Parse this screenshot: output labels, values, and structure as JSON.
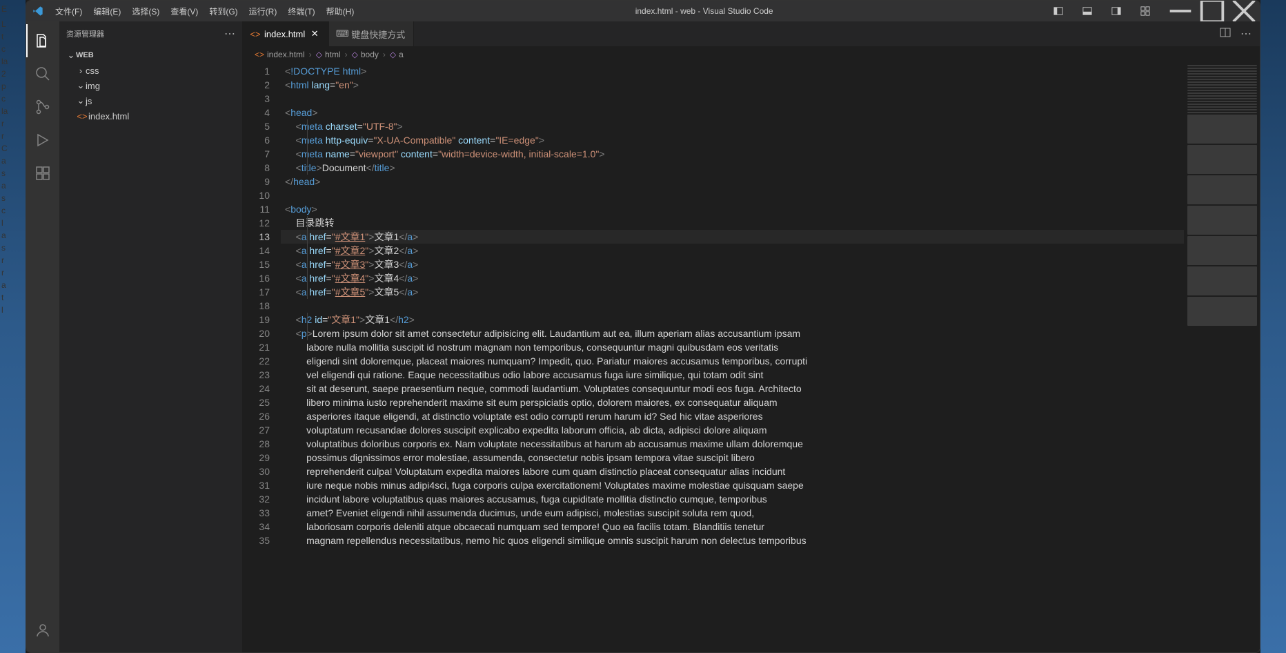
{
  "window": {
    "title": "index.html - web - Visual Studio Code",
    "menus": [
      "文件(F)",
      "编辑(E)",
      "选择(S)",
      "查看(V)",
      "转到(G)",
      "运行(R)",
      "终端(T)",
      "帮助(H)"
    ]
  },
  "sidebar": {
    "title": "资源管理器",
    "root": "WEB",
    "folders": [
      {
        "name": "css",
        "expanded": false
      },
      {
        "name": "img",
        "expanded": true
      },
      {
        "name": "js",
        "expanded": true
      }
    ],
    "files": [
      {
        "name": "index.html"
      }
    ]
  },
  "tabs": [
    {
      "label": "index.html",
      "active": true,
      "icon": "html"
    },
    {
      "label": "键盘快捷方式",
      "active": false,
      "icon": "keyboard"
    }
  ],
  "breadcrumb": [
    {
      "label": "index.html",
      "icon": "file-html"
    },
    {
      "label": "html",
      "icon": "symbol"
    },
    {
      "label": "body",
      "icon": "symbol"
    },
    {
      "label": "a",
      "icon": "symbol"
    }
  ],
  "editor": {
    "current_line": 13,
    "lines": [
      {
        "n": 1,
        "segs": [
          [
            "<",
            "bracket"
          ],
          [
            "!DOCTYPE ",
            "doctype"
          ],
          [
            "html",
            "tag"
          ],
          [
            ">",
            "bracket"
          ]
        ]
      },
      {
        "n": 2,
        "segs": [
          [
            "<",
            "bracket"
          ],
          [
            "html ",
            "tag"
          ],
          [
            "lang",
            "attr"
          ],
          [
            "=",
            "eq"
          ],
          [
            "\"en\"",
            "str"
          ],
          [
            ">",
            "bracket"
          ]
        ]
      },
      {
        "n": 3,
        "segs": []
      },
      {
        "n": 4,
        "segs": [
          [
            "<",
            "bracket"
          ],
          [
            "head",
            "tag"
          ],
          [
            ">",
            "bracket"
          ]
        ]
      },
      {
        "n": 5,
        "indent": 1,
        "segs": [
          [
            "    <",
            "bracket"
          ],
          [
            "meta ",
            "tag"
          ],
          [
            "charset",
            "attr"
          ],
          [
            "=",
            "eq"
          ],
          [
            "\"UTF-8\"",
            "str"
          ],
          [
            ">",
            "bracket"
          ]
        ]
      },
      {
        "n": 6,
        "indent": 1,
        "segs": [
          [
            "    <",
            "bracket"
          ],
          [
            "meta ",
            "tag"
          ],
          [
            "http-equiv",
            "attr"
          ],
          [
            "=",
            "eq"
          ],
          [
            "\"X-UA-Compatible\"",
            "str"
          ],
          [
            " content",
            "attr"
          ],
          [
            "=",
            "eq"
          ],
          [
            "\"IE=edge\"",
            "str"
          ],
          [
            ">",
            "bracket"
          ]
        ]
      },
      {
        "n": 7,
        "indent": 1,
        "segs": [
          [
            "    <",
            "bracket"
          ],
          [
            "meta ",
            "tag"
          ],
          [
            "name",
            "attr"
          ],
          [
            "=",
            "eq"
          ],
          [
            "\"viewport\"",
            "str"
          ],
          [
            " content",
            "attr"
          ],
          [
            "=",
            "eq"
          ],
          [
            "\"width=device-width, initial-scale=1.0\"",
            "str"
          ],
          [
            ">",
            "bracket"
          ]
        ]
      },
      {
        "n": 8,
        "indent": 1,
        "segs": [
          [
            "    <",
            "bracket"
          ],
          [
            "title",
            "tag"
          ],
          [
            ">",
            "bracket"
          ],
          [
            "Document",
            "text"
          ],
          [
            "</",
            "bracket"
          ],
          [
            "title",
            "tag"
          ],
          [
            ">",
            "bracket"
          ]
        ]
      },
      {
        "n": 9,
        "segs": [
          [
            "</",
            "bracket"
          ],
          [
            "head",
            "tag"
          ],
          [
            ">",
            "bracket"
          ]
        ]
      },
      {
        "n": 10,
        "segs": []
      },
      {
        "n": 11,
        "segs": [
          [
            "<",
            "bracket"
          ],
          [
            "body",
            "tag"
          ],
          [
            ">",
            "bracket"
          ]
        ]
      },
      {
        "n": 12,
        "indent": 1,
        "segs": [
          [
            "    目录跳转",
            "text"
          ]
        ]
      },
      {
        "n": 13,
        "indent": 1,
        "segs": [
          [
            "    <",
            "bracket"
          ],
          [
            "a ",
            "tag"
          ],
          [
            "href",
            "attr"
          ],
          [
            "=",
            "eq"
          ],
          [
            "\"",
            "str"
          ],
          [
            "#文章1",
            "str-u"
          ],
          [
            "\"",
            "str"
          ],
          [
            ">",
            "bracket"
          ],
          [
            "文章1",
            "text"
          ],
          [
            "</",
            "bracket"
          ],
          [
            "a",
            "tag"
          ],
          [
            ">",
            "bracket"
          ]
        ]
      },
      {
        "n": 14,
        "indent": 1,
        "segs": [
          [
            "    <",
            "bracket"
          ],
          [
            "a ",
            "tag"
          ],
          [
            "href",
            "attr"
          ],
          [
            "=",
            "eq"
          ],
          [
            "\"",
            "str"
          ],
          [
            "#文章2",
            "str-u"
          ],
          [
            "\"",
            "str"
          ],
          [
            ">",
            "bracket"
          ],
          [
            "文章2",
            "text"
          ],
          [
            "</",
            "bracket"
          ],
          [
            "a",
            "tag"
          ],
          [
            ">",
            "bracket"
          ]
        ]
      },
      {
        "n": 15,
        "indent": 1,
        "segs": [
          [
            "    <",
            "bracket"
          ],
          [
            "a ",
            "tag"
          ],
          [
            "href",
            "attr"
          ],
          [
            "=",
            "eq"
          ],
          [
            "\"",
            "str"
          ],
          [
            "#文章3",
            "str-u"
          ],
          [
            "\"",
            "str"
          ],
          [
            ">",
            "bracket"
          ],
          [
            "文章3",
            "text"
          ],
          [
            "</",
            "bracket"
          ],
          [
            "a",
            "tag"
          ],
          [
            ">",
            "bracket"
          ]
        ]
      },
      {
        "n": 16,
        "indent": 1,
        "segs": [
          [
            "    <",
            "bracket"
          ],
          [
            "a ",
            "tag"
          ],
          [
            "href",
            "attr"
          ],
          [
            "=",
            "eq"
          ],
          [
            "\"",
            "str"
          ],
          [
            "#文章4",
            "str-u"
          ],
          [
            "\"",
            "str"
          ],
          [
            ">",
            "bracket"
          ],
          [
            "文章4",
            "text"
          ],
          [
            "</",
            "bracket"
          ],
          [
            "a",
            "tag"
          ],
          [
            ">",
            "bracket"
          ]
        ]
      },
      {
        "n": 17,
        "indent": 1,
        "segs": [
          [
            "    <",
            "bracket"
          ],
          [
            "a ",
            "tag"
          ],
          [
            "href",
            "attr"
          ],
          [
            "=",
            "eq"
          ],
          [
            "\"",
            "str"
          ],
          [
            "#文章5",
            "str-u"
          ],
          [
            "\"",
            "str"
          ],
          [
            ">",
            "bracket"
          ],
          [
            "文章5",
            "text"
          ],
          [
            "</",
            "bracket"
          ],
          [
            "a",
            "tag"
          ],
          [
            ">",
            "bracket"
          ]
        ]
      },
      {
        "n": 18,
        "segs": []
      },
      {
        "n": 19,
        "indent": 1,
        "segs": [
          [
            "    <",
            "bracket"
          ],
          [
            "h2 ",
            "tag"
          ],
          [
            "id",
            "attr"
          ],
          [
            "=",
            "eq"
          ],
          [
            "\"文章1\"",
            "str"
          ],
          [
            ">",
            "bracket"
          ],
          [
            "文章1",
            "text"
          ],
          [
            "</",
            "bracket"
          ],
          [
            "h2",
            "tag"
          ],
          [
            ">",
            "bracket"
          ]
        ]
      },
      {
        "n": 20,
        "indent": 1,
        "segs": [
          [
            "    <",
            "bracket"
          ],
          [
            "p",
            "tag"
          ],
          [
            ">",
            "bracket"
          ],
          [
            "Lorem ipsum dolor sit amet consectetur adipisicing elit. Laudantium aut ea, illum aperiam alias accusantium ipsam",
            "text"
          ]
        ]
      },
      {
        "n": 21,
        "segs": [
          [
            "        labore nulla mollitia suscipit id nostrum magnam non temporibus, consequuntur magni quibusdam eos veritatis",
            "text"
          ]
        ]
      },
      {
        "n": 22,
        "segs": [
          [
            "        eligendi sint doloremque, placeat maiores numquam? Impedit, quo. Pariatur maiores accusamus temporibus, corrupti",
            "text"
          ]
        ]
      },
      {
        "n": 23,
        "segs": [
          [
            "        vel eligendi qui ratione. Eaque necessitatibus odio labore accusamus fuga iure similique, qui totam odit sint",
            "text"
          ]
        ]
      },
      {
        "n": 24,
        "segs": [
          [
            "        sit at deserunt, saepe praesentium neque, commodi laudantium. Voluptates consequuntur modi eos fuga. Architecto",
            "text"
          ]
        ]
      },
      {
        "n": 25,
        "segs": [
          [
            "        libero minima iusto reprehenderit maxime sit eum perspiciatis optio, dolorem maiores, ex consequatur aliquam",
            "text"
          ]
        ]
      },
      {
        "n": 26,
        "segs": [
          [
            "        asperiores itaque eligendi, at distinctio voluptate est odio corrupti rerum harum id? Sed hic vitae asperiores",
            "text"
          ]
        ]
      },
      {
        "n": 27,
        "segs": [
          [
            "        voluptatum recusandae dolores suscipit explicabo expedita laborum officia, ab dicta, adipisci dolore aliquam",
            "text"
          ]
        ]
      },
      {
        "n": 28,
        "segs": [
          [
            "        voluptatibus doloribus corporis ex. Nam voluptate necessitatibus at harum ab accusamus maxime ullam doloremque",
            "text"
          ]
        ]
      },
      {
        "n": 29,
        "segs": [
          [
            "        possimus dignissimos error molestiae, assumenda, consectetur nobis ipsam tempora vitae suscipit libero",
            "text"
          ]
        ]
      },
      {
        "n": 30,
        "segs": [
          [
            "        reprehenderit culpa! Voluptatum expedita maiores labore cum quam distinctio placeat consequatur alias incidunt",
            "text"
          ]
        ]
      },
      {
        "n": 31,
        "segs": [
          [
            "        iure neque nobis minus adipi4sci, fuga corporis culpa exercitationem! Voluptates maxime molestiae quisquam saepe",
            "text"
          ]
        ]
      },
      {
        "n": 32,
        "segs": [
          [
            "        incidunt labore voluptatibus quas maiores accusamus, fuga cupiditate mollitia distinctio cumque, temporibus",
            "text"
          ]
        ]
      },
      {
        "n": 33,
        "segs": [
          [
            "        amet? Eveniet eligendi nihil assumenda ducimus, unde eum adipisci, molestias suscipit soluta rem quod,",
            "text"
          ]
        ]
      },
      {
        "n": 34,
        "segs": [
          [
            "        laboriosam corporis deleniti atque obcaecati numquam sed tempore! Quo ea facilis totam. Blanditiis tenetur",
            "text"
          ]
        ]
      },
      {
        "n": 35,
        "segs": [
          [
            "        magnam repellendus necessitatibus, nemo hic quos eligendi similique omnis suscipit harum non delectus temporibus",
            "text"
          ]
        ]
      }
    ]
  }
}
